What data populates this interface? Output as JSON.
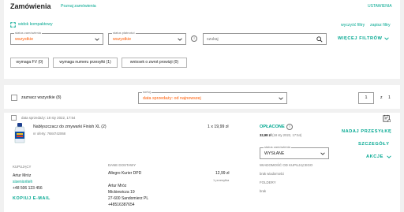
{
  "header": {
    "title": "Zamówienia",
    "subtitle_link": "Poznaj zamówienia",
    "settings_link": "USTAWIENIA"
  },
  "filters": {
    "compact_view": "widok kompaktowy",
    "clear_filters": "wyczyść filtry",
    "save_filters": "zapisz filtry",
    "order_status_label": "status zamówienia",
    "order_status_value": "wszystkie",
    "payment_status_label": "status płatności",
    "payment_status_value": "wszystkie",
    "search_placeholder": "szukaj",
    "more_filters": "WIĘCEJ FILTRÓW",
    "chips": [
      "wymaga FV (0)",
      "wymaga numeru przesyłki (1)",
      "wniosek o zwrot prowizji (0)"
    ]
  },
  "list": {
    "select_all": "zaznacz wszystkie (8)",
    "sort_label": "sortuj",
    "sort_value": "data sprzedaży: od najnowszej",
    "page_current": "1",
    "page_sep": "z",
    "page_total": "1"
  },
  "order": {
    "sale_date_label": "data sprzedaży:",
    "sale_date": "18 sty 2022, 17:54",
    "product_name": "Nabłyszczacz do zmywarki Finish XL (2)",
    "offer_label": "nr oferty:",
    "offer_number": "7684742068",
    "quantity_price": "1 x 19,99 zł",
    "payment_status": "OPŁACONE",
    "paid_amount": "32,98 zł",
    "paid_date": "(18 sty 2022, 17:54)",
    "order_status_label": "status zamówienia",
    "order_status_value": "WYSŁANE",
    "actions": {
      "send_parcel": "NADAJ PRZESYŁKĘ",
      "details": "SZCZEGÓŁY",
      "actions": "AKCJE"
    },
    "buyer": {
      "heading": "KUPUJĄCY",
      "name": "Artur Mróz",
      "login": "sisenioriteh",
      "phone": "+48 506 123 456",
      "copy_email": "KOPIUJ E-MAIL"
    },
    "delivery": {
      "heading": "DANE DOSTAWY",
      "method": "Allegro Kurier DPD",
      "price": "12,99 zł",
      "parcels": "1 przesyłka",
      "name": "Artur Mróz",
      "street": "Mickiewicza 19",
      "city": "27-600 Sandomierz PL",
      "phone": "+48516387654"
    },
    "message": {
      "heading": "WIADOMOŚĆ OD KUPUJĄCEGO",
      "text": "brak wiadomości",
      "folders_heading": "FOLDERY",
      "folders_text": "brak"
    }
  },
  "colors": {
    "accent": "#00a790",
    "orange": "#ff5a00",
    "background": "#f1f1f1"
  }
}
